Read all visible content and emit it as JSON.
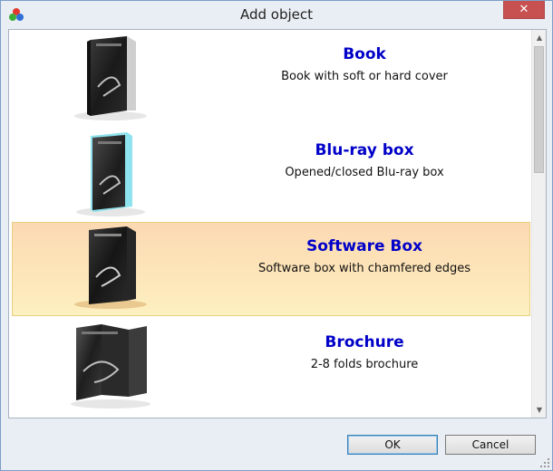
{
  "window": {
    "title": "Add object",
    "close_glyph": "✕"
  },
  "items": [
    {
      "title": "Book",
      "description": "Book with soft or hard cover",
      "icon": "book-thumbnail",
      "selected": false
    },
    {
      "title": "Blu-ray box",
      "description": "Opened/closed Blu-ray box",
      "icon": "bluray-box-thumbnail",
      "selected": false
    },
    {
      "title": "Software Box",
      "description": "Software box with chamfered edges",
      "icon": "software-box-thumbnail",
      "selected": true
    },
    {
      "title": "Brochure",
      "description": "2-8 folds brochure",
      "icon": "brochure-thumbnail",
      "selected": false
    }
  ],
  "buttons": {
    "ok": "OK",
    "cancel": "Cancel"
  },
  "colors": {
    "title_link": "#0000c8",
    "selection": "#fde3b8",
    "close": "#c75050"
  }
}
